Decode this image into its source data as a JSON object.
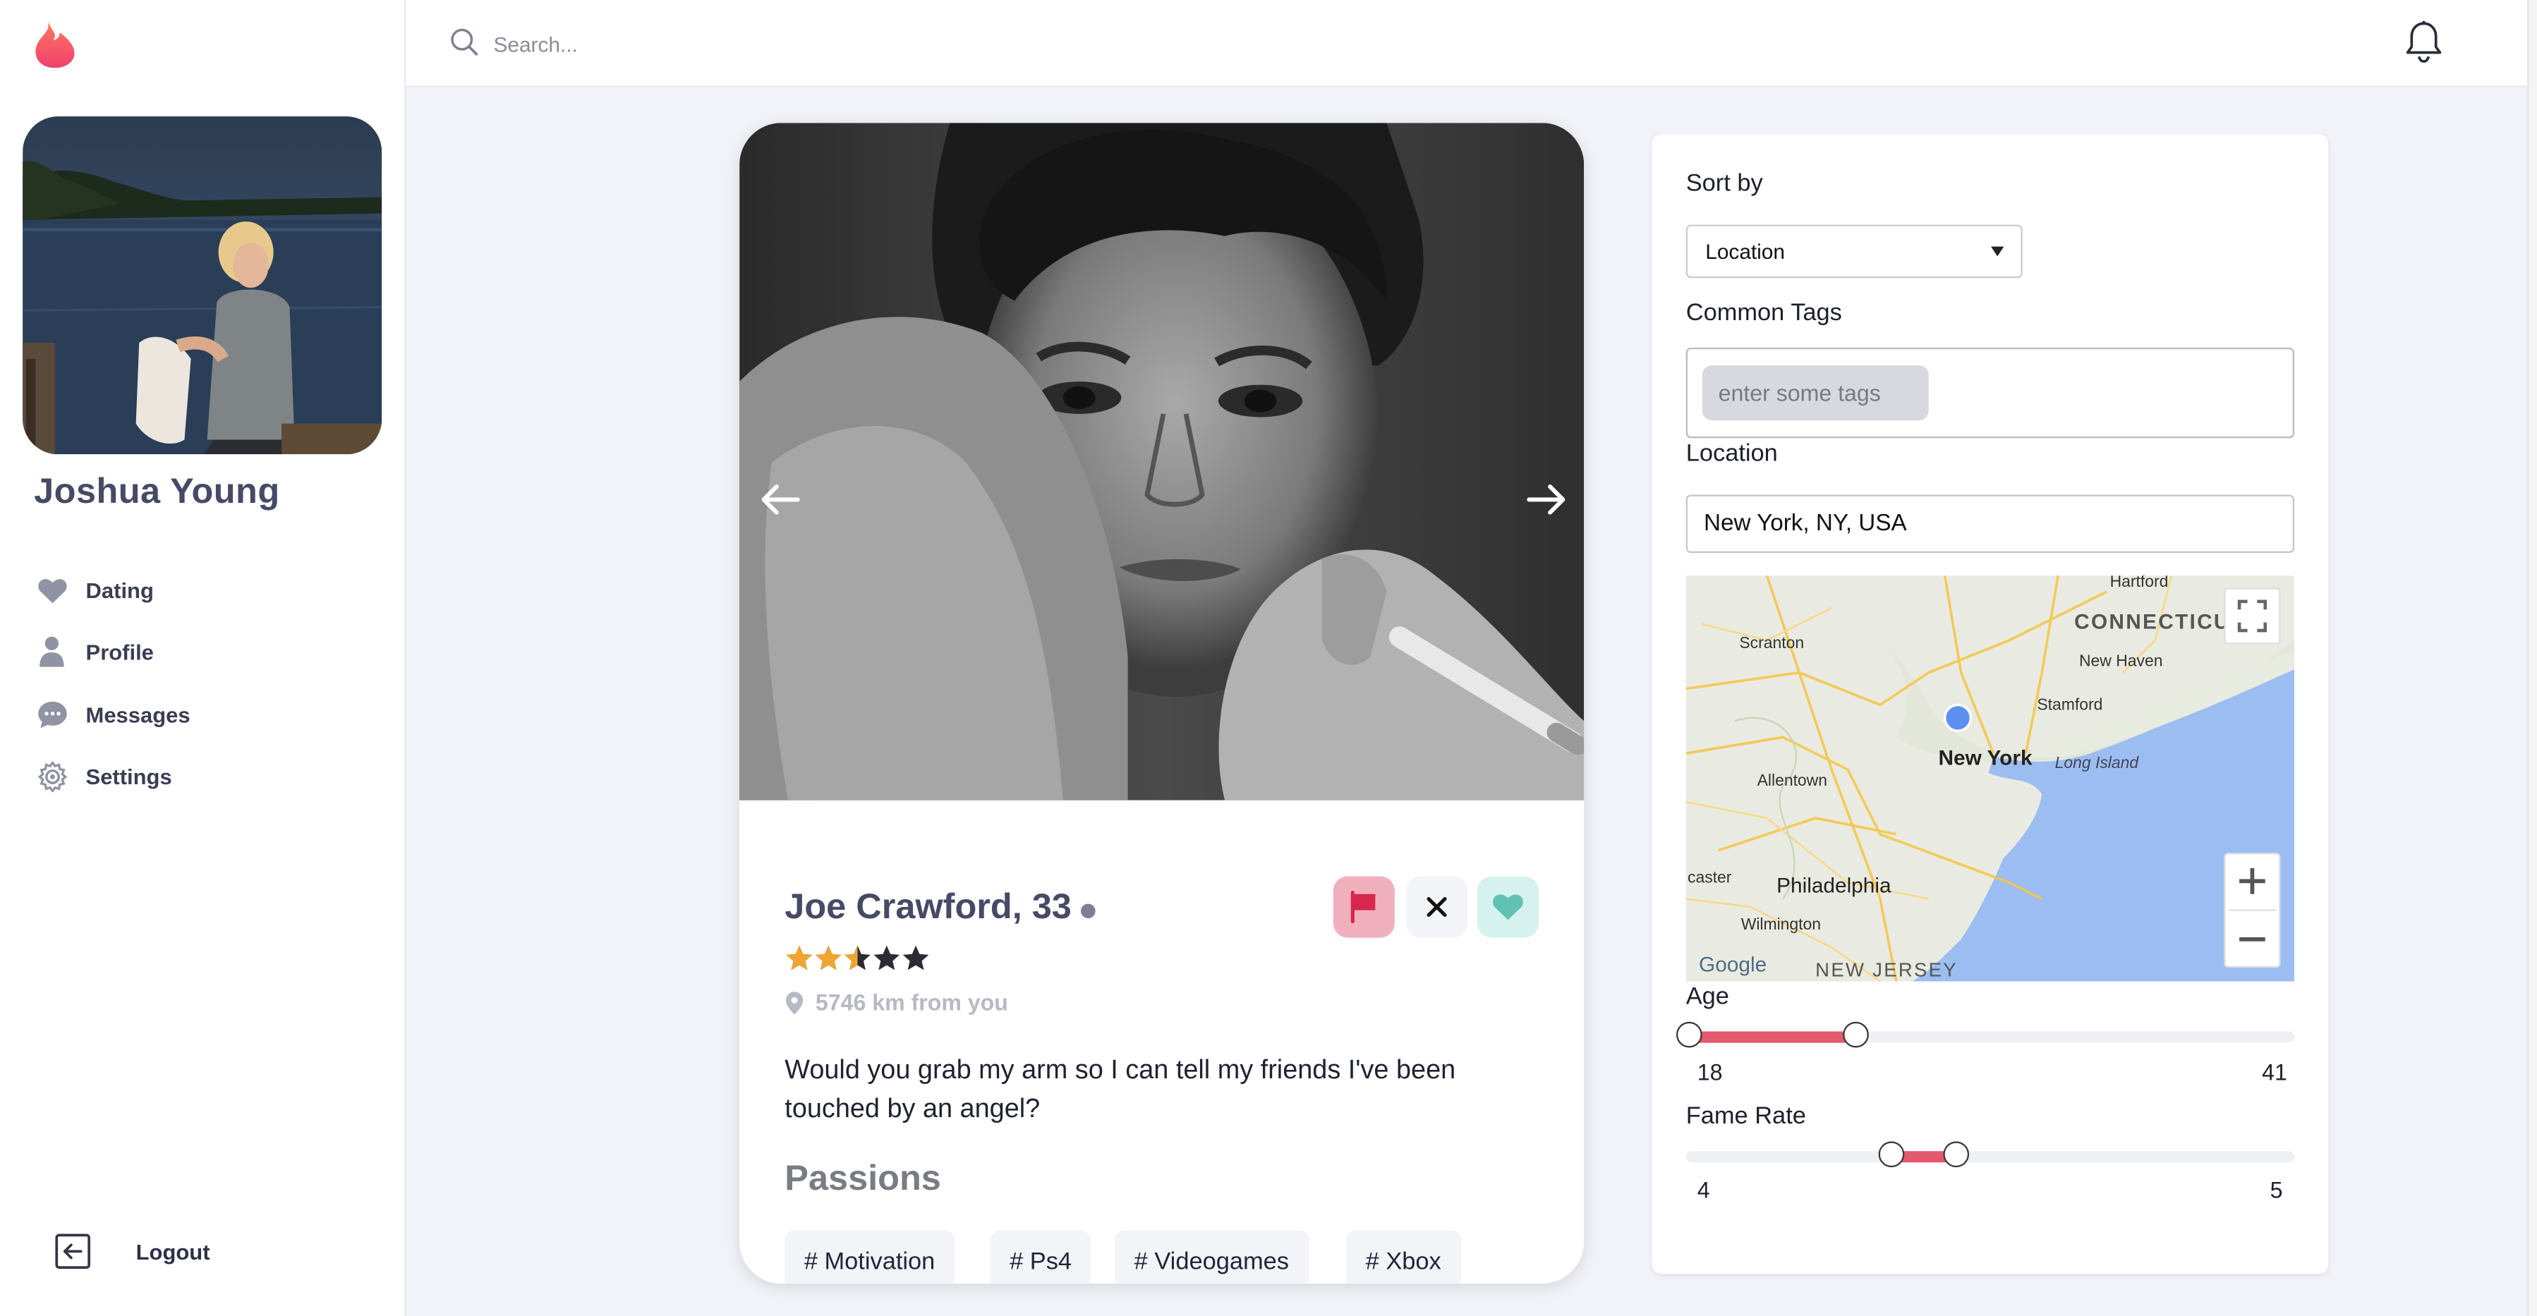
{
  "sidebar": {
    "user_name": "Joshua Young",
    "nav": [
      {
        "label": "Dating",
        "icon": "heart-icon"
      },
      {
        "label": "Profile",
        "icon": "person-icon"
      },
      {
        "label": "Messages",
        "icon": "chat-icon"
      },
      {
        "label": "Settings",
        "icon": "gear-icon"
      }
    ],
    "logout_label": "Logout"
  },
  "topbar": {
    "search_placeholder": "Search..."
  },
  "profile": {
    "name_age": "Joe Crawford, 33",
    "rating": 2.5,
    "rating_max": 5,
    "distance": "5746 km from you",
    "bio": "Would you grab my arm so I can tell my friends I've been touched by an angel?",
    "passions_title": "Passions",
    "tags": [
      "# Motivation",
      "# Ps4",
      "# Videogames",
      "# Xbox"
    ]
  },
  "filters": {
    "sort_label": "Sort by",
    "sort_value": "Location",
    "common_tags_label": "Common Tags",
    "tags_placeholder": "enter some tags",
    "location_label": "Location",
    "location_value": "New York, NY, USA",
    "map_labels": {
      "hartford": "Hartford",
      "connecticut": "CONNECTICUT",
      "scranton": "Scranton",
      "new_haven": "New Haven",
      "stamford": "Stamford",
      "new_york": "New York",
      "long_island": "Long Island",
      "allentown": "Allentown",
      "philadelphia": "Philadelphia",
      "wilmington": "Wilmington",
      "lancaster": "caster",
      "new_jersey": "NEW JERSEY",
      "google": "Google"
    },
    "age_label": "Age",
    "age_min": "18",
    "age_max": "41",
    "age_range": [
      18,
      41
    ],
    "fame_label": "Fame Rate",
    "fame_min": "4",
    "fame_max": "5",
    "fame_range": [
      4,
      5
    ]
  },
  "colors": {
    "accent": "#e4596d",
    "brand_flame": "#f3546a",
    "report_button": "#f0b0bd",
    "like_button": "#d6f2ee",
    "map_water": "#9cbdf1"
  }
}
